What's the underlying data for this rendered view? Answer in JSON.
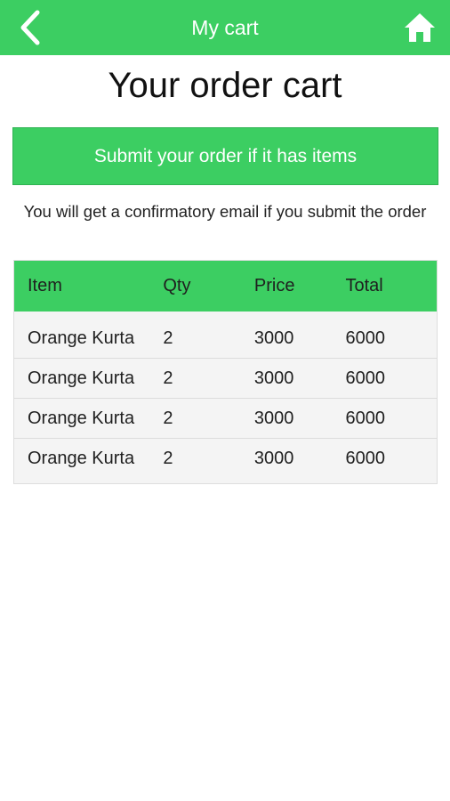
{
  "appbar": {
    "title": "My cart",
    "back_icon": "chevron-left-icon",
    "home_icon": "home-icon",
    "color": "#3cce62"
  },
  "page": {
    "title": "Your order cart",
    "submit_label": "Submit your order if it has items",
    "info_text": "You will get a confirmatory email if you submit the order"
  },
  "table": {
    "headers": [
      "Item",
      "Qty",
      "Price",
      "Total"
    ],
    "rows": [
      [
        "Orange Kurta",
        "2",
        "3000",
        "6000"
      ],
      [
        "Orange Kurta",
        "2",
        "3000",
        "6000"
      ],
      [
        "Orange Kurta",
        "2",
        "3000",
        "6000"
      ],
      [
        "Orange Kurta",
        "2",
        "3000",
        "6000"
      ]
    ]
  }
}
